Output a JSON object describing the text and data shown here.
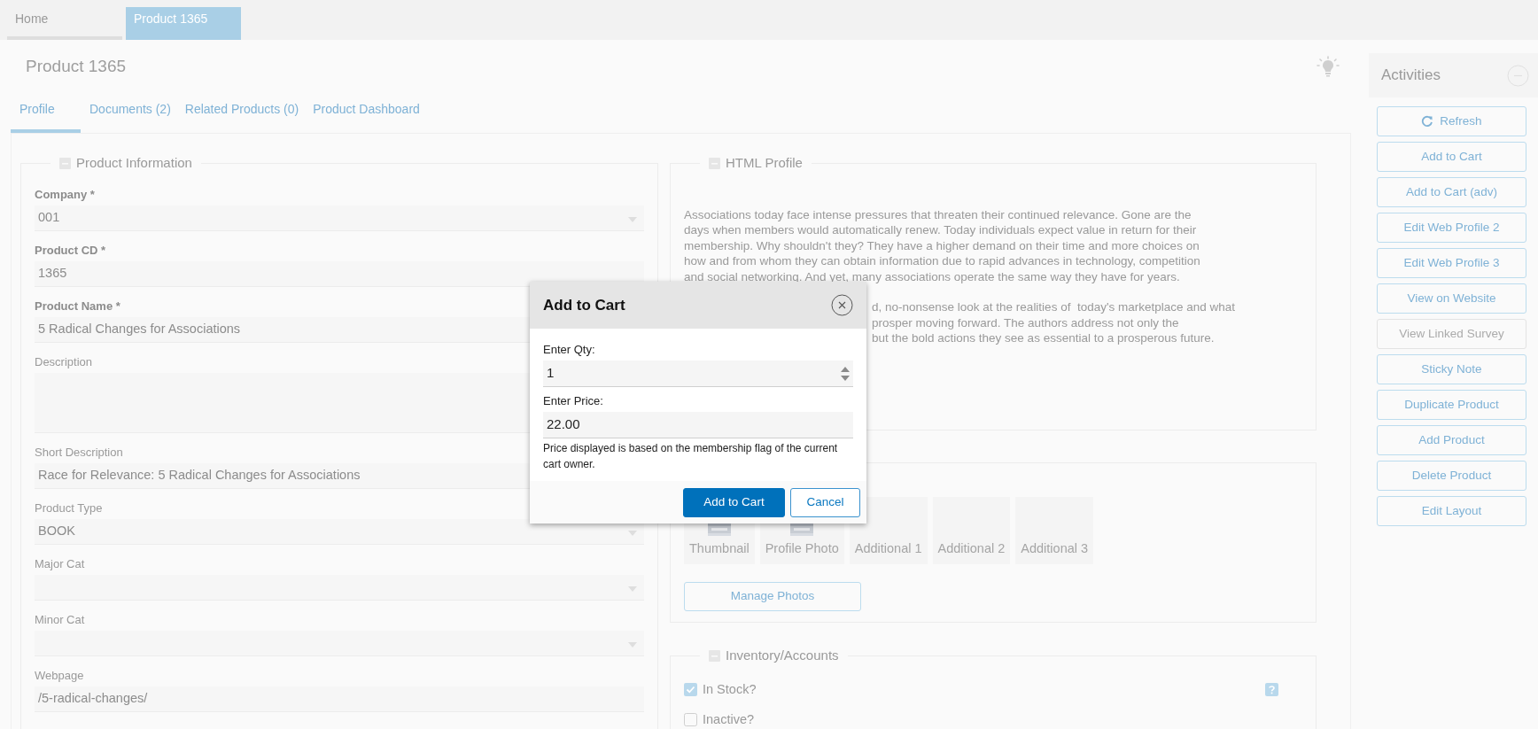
{
  "top_tabs": [
    {
      "label": "Home",
      "selected": false
    },
    {
      "label": "Product 1365",
      "selected": true
    }
  ],
  "page_title": "Product 1365",
  "tabs": [
    {
      "label": "Profile",
      "selected": true
    },
    {
      "label": "Documents (2)",
      "selected": false
    },
    {
      "label": "Related Products (0)",
      "selected": false
    },
    {
      "label": "Product Dashboard",
      "selected": false
    }
  ],
  "product_information": {
    "legend": "Product Information",
    "fields": [
      {
        "label": "Company *",
        "required": true,
        "kind": "select",
        "value": "001"
      },
      {
        "label": "Product CD *",
        "required": true,
        "kind": "text",
        "value": "1365"
      },
      {
        "label": "Product Name *",
        "required": true,
        "kind": "text",
        "value": "5 Radical Changes for Associations"
      },
      {
        "label": "Description",
        "required": false,
        "kind": "textarea"
      },
      {
        "label": "Short Description",
        "required": false,
        "kind": "text",
        "value": "Race for Relevance: 5 Radical Changes for Associations"
      },
      {
        "label": "Product Type",
        "required": false,
        "kind": "select",
        "value": "BOOK"
      },
      {
        "label": "Major Cat",
        "required": false,
        "kind": "select"
      },
      {
        "label": "Minor Cat",
        "required": false,
        "kind": "select"
      },
      {
        "label": "Webpage",
        "required": false,
        "kind": "text",
        "value": "/5-radical-changes/"
      }
    ]
  },
  "html_profile": {
    "legend": "HTML Profile",
    "paragraph_lines": [
      "Associations today face intense pressures that threaten their continued relevance. Gone are the",
      "days when members would automatically renew. Today individuals expect value in return for their",
      "membership. Why shouldn't they? They have a higher demand on their time and more choices on",
      "how and from whom they can obtain information due to rapid advances in technology, competition",
      "and social networking. And yet, many associations operate the same way they have for years."
    ],
    "partial_lines": [
      "d, no-nonsense look at the realities of  today's marketplace and what",
      "prosper moving forward. The authors address not only the",
      "but the bold actions they see as essential to a prosperous future."
    ]
  },
  "photos": {
    "tiles": [
      {
        "label": "Thumbnail",
        "has_image": true
      },
      {
        "label": "Profile Photo",
        "has_image": true
      },
      {
        "label": "Additional 1",
        "has_image": false
      },
      {
        "label": "Additional 2",
        "has_image": false
      },
      {
        "label": "Additional 3",
        "has_image": false
      }
    ],
    "manage_button": "Manage Photos"
  },
  "inventory": {
    "legend": "Inventory/Accounts",
    "checks": [
      {
        "label": "In Stock?",
        "checked": true,
        "help": true
      },
      {
        "label": "Inactive?",
        "checked": false,
        "help": false
      }
    ]
  },
  "activities": {
    "title": "Activities",
    "buttons": [
      {
        "label": "Refresh",
        "kind": "refresh",
        "disabled": false
      },
      {
        "label": "Add to Cart",
        "kind": "plain",
        "disabled": false
      },
      {
        "label": "Add to Cart (adv)",
        "kind": "plain",
        "disabled": false
      },
      {
        "label": "Edit Web Profile 2",
        "kind": "plain",
        "disabled": false
      },
      {
        "label": "Edit Web Profile 3",
        "kind": "plain",
        "disabled": false
      },
      {
        "label": "View on Website",
        "kind": "plain",
        "disabled": false
      },
      {
        "label": "View Linked Survey",
        "kind": "plain",
        "disabled": true
      },
      {
        "label": "Sticky Note",
        "kind": "plain",
        "disabled": false
      },
      {
        "label": "Duplicate Product",
        "kind": "plain",
        "disabled": false
      },
      {
        "label": "Add Product",
        "kind": "plain",
        "disabled": false
      },
      {
        "label": "Delete Product",
        "kind": "plain",
        "disabled": false
      },
      {
        "label": "Edit Layout",
        "kind": "plain",
        "disabled": false
      }
    ]
  },
  "dialog": {
    "title": "Add to Cart",
    "fields": [
      {
        "label": "Enter Qty:",
        "kind": "number",
        "value": "1"
      },
      {
        "label": "Enter Price:",
        "kind": "text",
        "value": "22.00"
      }
    ],
    "note": "Price displayed is based on the membership flag of the current cart owner.",
    "buttons": [
      {
        "label": "Add to Cart",
        "kind": "primary"
      },
      {
        "label": "Cancel",
        "kind": "secondary"
      }
    ]
  }
}
